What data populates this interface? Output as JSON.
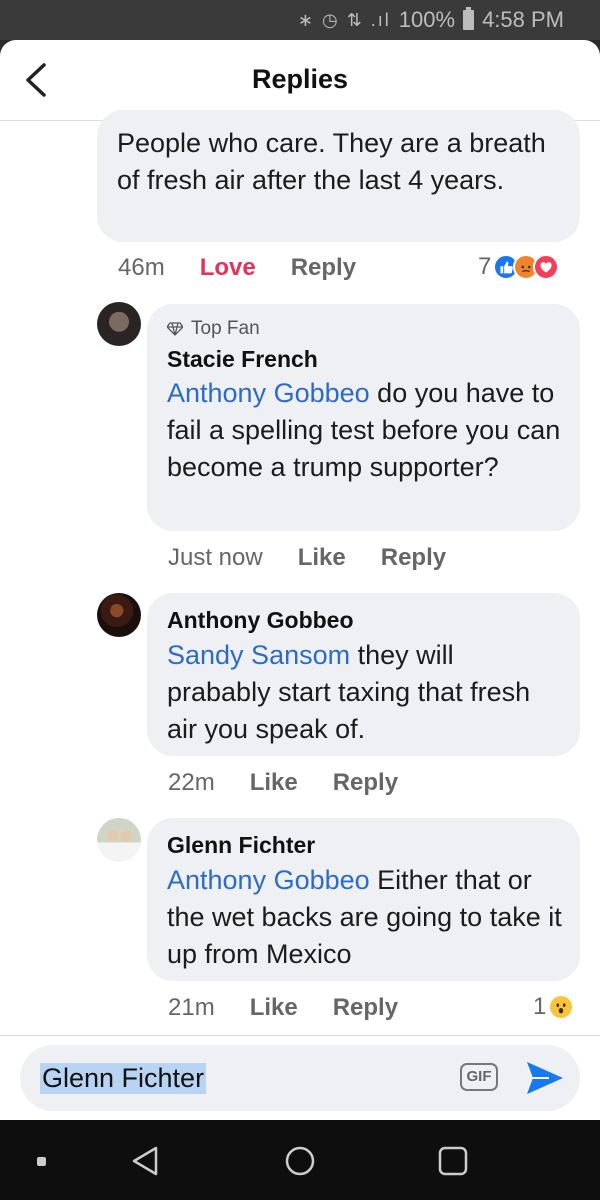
{
  "status_bar": {
    "battery": "100%",
    "time": "4:58 PM",
    "icons": "∗ ◷ ⇅ .ıl"
  },
  "header": {
    "title": "Replies"
  },
  "comments": [
    {
      "body": "People who care. They are a breath of fresh air after the last 4 years.",
      "time": "46m",
      "reaction_label": "Love",
      "reply_label": "Reply",
      "reaction_count": "7"
    },
    {
      "badge": "Top Fan",
      "author": "Stacie French",
      "mention": "Anthony Gobbeo",
      "body": " do you have to fail a spelling test before you can become a trump supporter?",
      "time": "Just now",
      "like_label": "Like",
      "reply_label": "Reply"
    },
    {
      "author": "Anthony Gobbeo",
      "mention": "Sandy Sansom",
      "body": " they will prabably start taxing that fresh air you speak of.",
      "time": "22m",
      "like_label": "Like",
      "reply_label": "Reply"
    },
    {
      "author": "Glenn Fichter",
      "mention": "Anthony Gobbeo",
      "body": " Either that or the wet backs are going to take it up from Mexico",
      "time": "21m",
      "like_label": "Like",
      "reply_label": "Reply",
      "reaction_count": "1"
    }
  ],
  "composer": {
    "value": "Glenn Fichter",
    "gif_label": "GIF"
  },
  "colors": {
    "accent": "#2d6bc9",
    "love": "#e2335a",
    "bubble": "#eef0f3"
  }
}
